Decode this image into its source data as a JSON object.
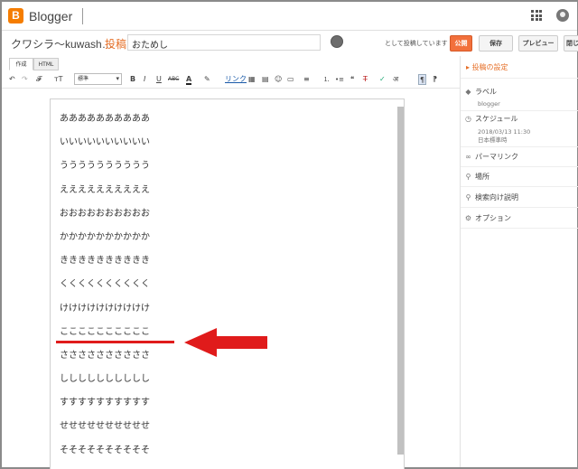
{
  "header": {
    "app_name": "Blogger",
    "logo_letter": "B",
    "blog_name": "クワシラ〜kuwash…",
    "separator": "·",
    "crumb": "投稿",
    "post_title": "おためし",
    "posting_as": "として投稿しています",
    "buttons": {
      "publish": "公開",
      "save": "保存",
      "preview": "プレビュー",
      "close": "閉じ"
    }
  },
  "mode_tabs": [
    "作成",
    "HTML"
  ],
  "toolbar": {
    "undo": "↶",
    "redo": "↷",
    "font": "𝓕",
    "font_size": "ᴛT",
    "format_select": "標準",
    "bold": "B",
    "italic": "I",
    "underline": "U",
    "strike": "ABC",
    "text_color": "A",
    "highlight": "✎",
    "link": "リンク",
    "align": "≡",
    "numbered_list": "⒈",
    "bullet_list": "•≡",
    "quote": "❝",
    "clear_format": "T̶",
    "spellcheck": "✓",
    "input_tools": "अ",
    "ltr": "¶",
    "rtl": "¶"
  },
  "editor": {
    "lines": [
      "ああああああああああ",
      "いいいいいいいいいい",
      "うううううううううう",
      "ええええええええええ",
      "おおおおおおおおおお",
      "かかかかかかかかかか",
      "きききききききききき",
      "くくくくくくくくくく",
      "けけけけけけけけけけ",
      "ここここここここここ",
      "ささささささささささ",
      "しししししししししし",
      "すすすすすすすすすす",
      "せせせせせせせせせせ",
      "そそそそそそそそそそ"
    ]
  },
  "settings_panel": {
    "title": "投稿の設定",
    "labels": {
      "title": "ラベル",
      "value": "blogger"
    },
    "schedule": {
      "title": "スケジュール",
      "datetime": "2018/03/13 11:30",
      "timezone": "日本標準時"
    },
    "permalink": "パーマリンク",
    "location": "場所",
    "search_description": "検索向け説明",
    "options": "オプション"
  },
  "colors": {
    "accent": "#e66f27",
    "publish": "#f2703c",
    "annotation": "#e01b1b"
  }
}
